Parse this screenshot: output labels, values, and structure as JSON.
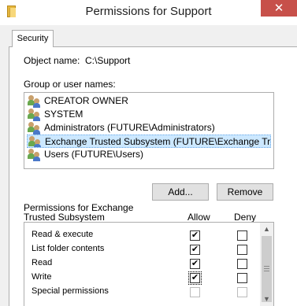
{
  "window": {
    "title": "Permissions for Support",
    "close_glyph": "✕",
    "icon": "folder-icon"
  },
  "tabs": [
    {
      "label": "Security",
      "active": true
    }
  ],
  "object": {
    "label": "Object name:",
    "value": "C:\\Support"
  },
  "group_label": "Group or user names:",
  "users": [
    {
      "name": "CREATOR OWNER",
      "icon": "users-icon",
      "selected": false
    },
    {
      "name": "SYSTEM",
      "icon": "users-icon",
      "selected": false
    },
    {
      "name": "Administrators (FUTURE\\Administrators)",
      "icon": "users-icon",
      "selected": false
    },
    {
      "name": "Exchange Trusted Subsystem (FUTURE\\Exchange Trusted...",
      "icon": "users-icon",
      "selected": true
    },
    {
      "name": "Users (FUTURE\\Users)",
      "icon": "users-icon",
      "selected": false
    }
  ],
  "buttons": {
    "add": "Add...",
    "remove": "Remove"
  },
  "permissions": {
    "label_line1": "Permissions for Exchange",
    "label_line2": "Trusted Subsystem",
    "col_allow": "Allow",
    "col_deny": "Deny",
    "rows": [
      {
        "name": "Read & execute",
        "allow": true,
        "deny": false,
        "disabled": false
      },
      {
        "name": "List folder contents",
        "allow": true,
        "deny": false,
        "disabled": false
      },
      {
        "name": "Read",
        "allow": true,
        "deny": false,
        "disabled": false
      },
      {
        "name": "Write",
        "allow": true,
        "deny": false,
        "disabled": false
      },
      {
        "name": "Special permissions",
        "allow": false,
        "deny": false,
        "disabled": true
      }
    ]
  },
  "scrollbar": {
    "up_glyph": "▲",
    "down_glyph": "▼"
  },
  "colors": {
    "selection": "#cce8ff",
    "close_button": "#c7504a",
    "dialog_bg": "#f0f0f0"
  }
}
